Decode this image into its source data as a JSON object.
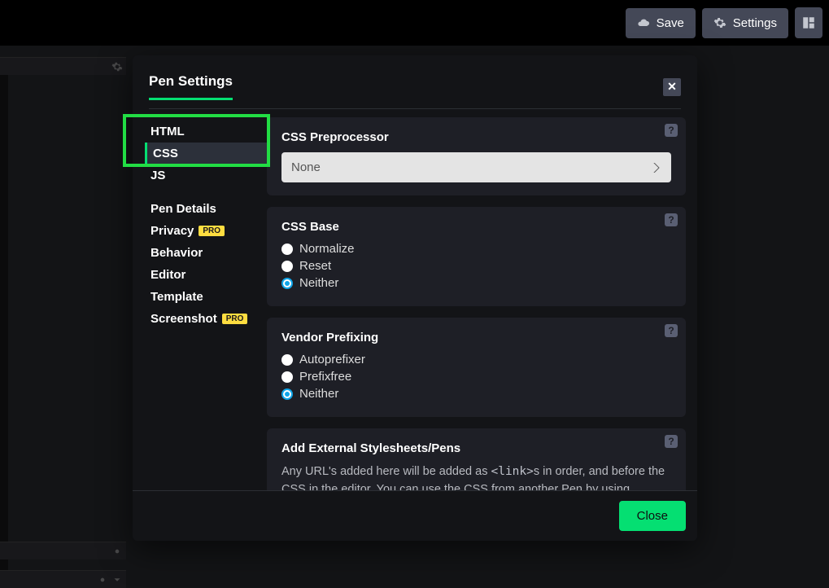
{
  "toolbar": {
    "save_label": "Save",
    "settings_label": "Settings"
  },
  "modal": {
    "title": "Pen Settings",
    "close_label": "Close",
    "nav": {
      "html": "HTML",
      "css": "CSS",
      "js": "JS",
      "pen_details": "Pen Details",
      "privacy": "Privacy",
      "behavior": "Behavior",
      "editor": "Editor",
      "template": "Template",
      "screenshot": "Screenshot",
      "pro_badge": "PRO"
    },
    "sections": {
      "preprocessor": {
        "heading": "CSS Preprocessor",
        "value": "None"
      },
      "css_base": {
        "heading": "CSS Base",
        "opt_normalize": "Normalize",
        "opt_reset": "Reset",
        "opt_neither": "Neither",
        "selected": "Neither"
      },
      "vendor": {
        "heading": "Vendor Prefixing",
        "opt_autoprefixer": "Autoprefixer",
        "opt_prefixfree": "Prefixfree",
        "opt_neither": "Neither",
        "selected": "Neither"
      },
      "external": {
        "heading": "Add External Stylesheets/Pens",
        "text_before": "Any URL's added here will be added as ",
        "code": "<link>",
        "text_after": "s in order, and before the CSS in the editor. You can use the CSS from another Pen by using"
      }
    }
  }
}
